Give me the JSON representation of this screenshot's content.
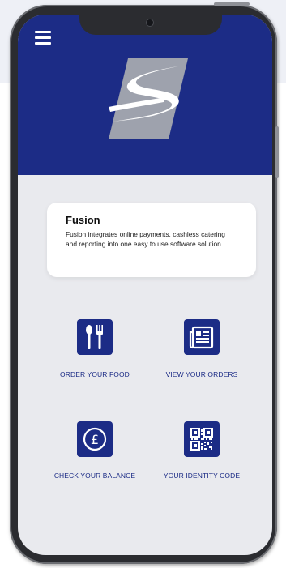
{
  "app": {
    "card": {
      "title": "Fusion",
      "description": "Fusion integrates online payments, cashless catering and reporting into one easy to use software solution."
    },
    "tiles": [
      {
        "label": "ORDER YOUR FOOD",
        "icon": "fork-knife-icon"
      },
      {
        "label": "VIEW YOUR ORDERS",
        "icon": "newspaper-icon"
      },
      {
        "label": "CHECK YOUR BALANCE",
        "icon": "pound-icon"
      },
      {
        "label": "YOUR IDENTITY CODE",
        "icon": "qr-code-icon"
      }
    ],
    "menu_icon": "hamburger-menu-icon",
    "logo_icon": "fusion-logo-icon"
  },
  "colors": {
    "brand": "#1c2c86",
    "screen_bg": "#e9eaee",
    "phone_frame": "#2b2c30"
  }
}
